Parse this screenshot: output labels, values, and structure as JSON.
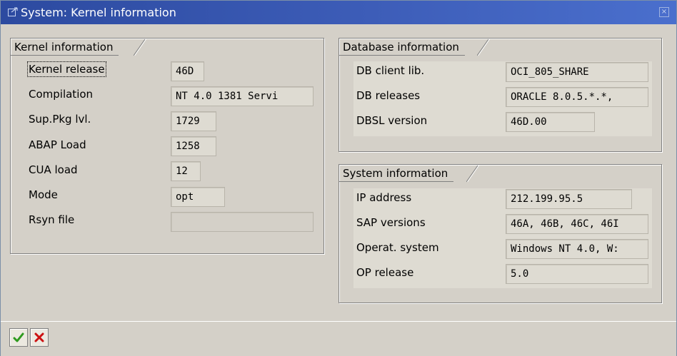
{
  "window": {
    "title": "System: Kernel information"
  },
  "kernel_info": {
    "heading": "Kernel information",
    "rows": [
      {
        "label": "Kernel release",
        "value": "46D"
      },
      {
        "label": "Compilation",
        "value": "NT 4.0 1381 Servi"
      },
      {
        "label": "Sup.Pkg lvl.",
        "value": "1729"
      },
      {
        "label": "ABAP Load",
        "value": "1258"
      },
      {
        "label": "CUA load",
        "value": "12"
      },
      {
        "label": "Mode",
        "value": "opt"
      },
      {
        "label": "Rsyn file",
        "value": ""
      }
    ]
  },
  "db_info": {
    "heading": "Database information",
    "rows": [
      {
        "label": "DB client lib.",
        "value": "OCI_805_SHARE"
      },
      {
        "label": "DB releases",
        "value": "ORACLE 8.0.5.*.*,"
      },
      {
        "label": "DBSL version",
        "value": "46D.00"
      }
    ]
  },
  "sys_info": {
    "heading": "System information",
    "rows": [
      {
        "label": "IP address",
        "value": "212.199.95.5"
      },
      {
        "label": "SAP versions",
        "value": "46A, 46B, 46C, 46I"
      },
      {
        "label": "Operat. system",
        "value": "Windows NT 4.0, W:"
      },
      {
        "label": "OP release",
        "value": "5.0"
      }
    ]
  },
  "toolbar": {
    "ok_icon": "checkmark-icon",
    "cancel_icon": "cancel-x-icon",
    "ok_color": "#2e9a1e",
    "cancel_color": "#cc1111"
  }
}
